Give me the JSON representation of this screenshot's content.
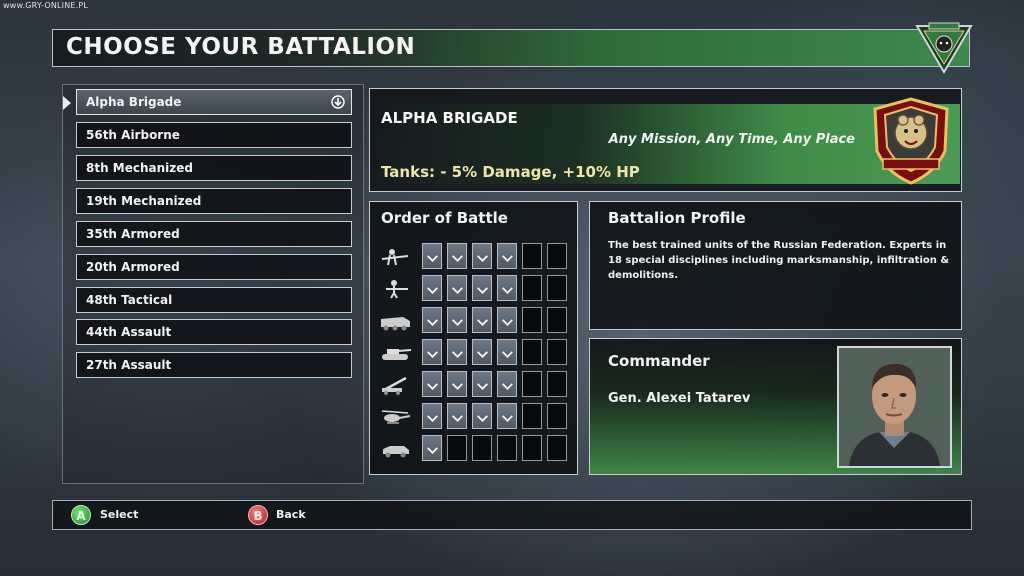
{
  "watermark": "www.GRY-ONLINE.PL",
  "header": {
    "title": "CHOOSE YOUR BATTALION",
    "emblem_icon": "spetsnaz-triangle-emblem"
  },
  "battalions": [
    {
      "label": "Alpha Brigade",
      "selected": true
    },
    {
      "label": "56th Airborne"
    },
    {
      "label": "8th Mechanized"
    },
    {
      "label": "19th Mechanized"
    },
    {
      "label": "35th Armored"
    },
    {
      "label": "20th Armored"
    },
    {
      "label": "48th Tactical"
    },
    {
      "label": "44th Assault"
    },
    {
      "label": "27th Assault"
    }
  ],
  "banner": {
    "name": "ALPHA BRIGADE",
    "motto": "Any Mission, Any Time, Any Place",
    "bonus": "Tanks: - 5% Damage, +10% HP",
    "emblem_icon": "bear-shield-emblem"
  },
  "order_of_battle": {
    "title": "Order of Battle",
    "rows": [
      {
        "icon": "rifleman-icon",
        "filled": 4,
        "total": 6
      },
      {
        "icon": "soldier-icon",
        "filled": 4,
        "total": 6
      },
      {
        "icon": "apc-icon",
        "filled": 4,
        "total": 6
      },
      {
        "icon": "tank-icon",
        "filled": 4,
        "total": 6
      },
      {
        "icon": "artillery-icon",
        "filled": 4,
        "total": 6
      },
      {
        "icon": "helicopter-icon",
        "filled": 4,
        "total": 6
      },
      {
        "icon": "recon-vehicle-icon",
        "filled": 1,
        "total": 6
      }
    ]
  },
  "profile": {
    "title": "Battalion Profile",
    "text": "The best trained units of the Russian Federation. Experts in 18 special disciplines including marksmanship, infiltration & demolitions."
  },
  "commander": {
    "title": "Commander",
    "name": "Gen. Alexei Tatarev"
  },
  "footer": {
    "select_glyph": "A",
    "select_label": "Select",
    "back_glyph": "B",
    "back_label": "Back"
  },
  "colors": {
    "accent_green": "#3f8b48",
    "bonus_yellow": "#efe6a6",
    "button_a": "#1e8a2a",
    "button_b": "#b01a1a"
  }
}
